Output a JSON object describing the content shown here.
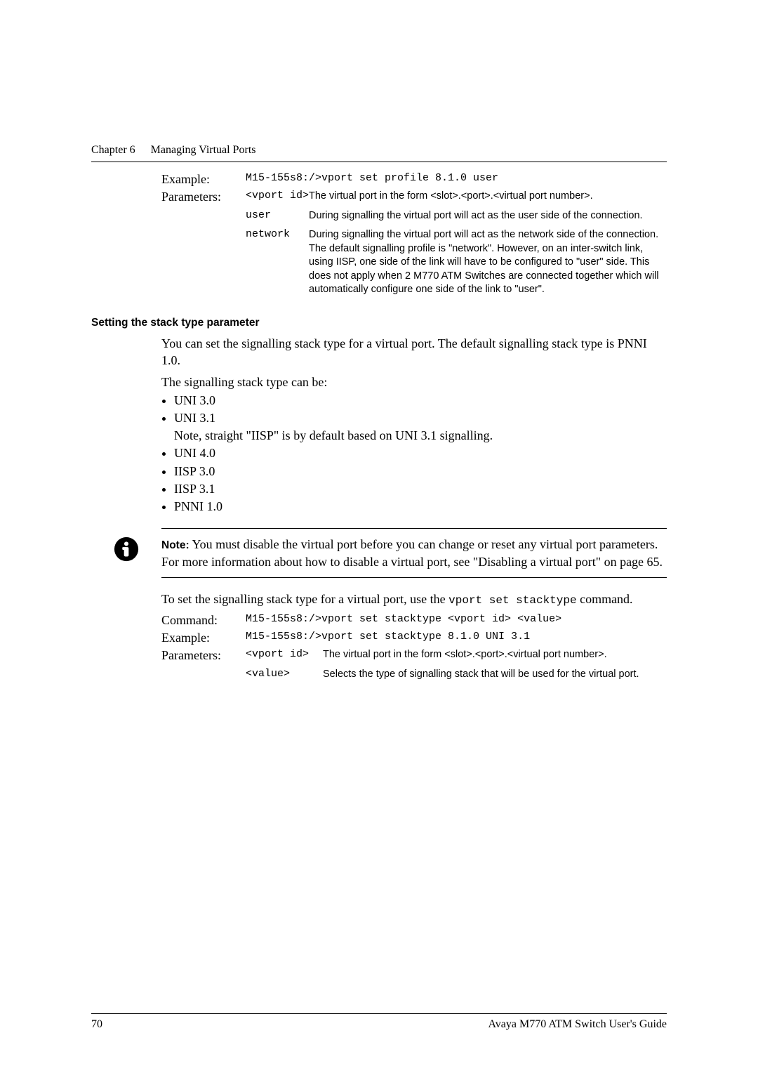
{
  "header": {
    "chapter_label": "Chapter 6",
    "chapter_title": "Managing Virtual Ports"
  },
  "block1": {
    "example_label": "Example:",
    "example_value": "M15-155s8:/>vport set profile 8.1.0 user",
    "parameters_label": "Parameters:",
    "params": [
      {
        "name": "<vport id>",
        "desc": "The virtual port in the form <slot>.<port>.<virtual port number>."
      },
      {
        "name": "user",
        "desc": "During signalling the virtual port will act as the user side of the connection."
      },
      {
        "name": "network",
        "desc": "During signalling the virtual port will act as the network side of the connection. The default signalling profile is \"network\". However, on an inter-switch link, using IISP, one side of the link will have to be configured to \"user\" side. This does not apply when 2 M770 ATM Switches are connected together which will automatically configure one side of the link to \"user\"."
      }
    ]
  },
  "section2": {
    "heading": "Setting the stack type parameter",
    "para1": "You can set the signalling stack type for a virtual port. The default signalling stack type is PNNI 1.0.",
    "para2": "The signalling stack type can be:",
    "list": {
      "i1": "UNI 3.0",
      "i2": "UNI 3.1",
      "i2_sub": "Note, straight \"IISP\" is by default based on UNI 3.1 signalling.",
      "i3": "UNI 4.0",
      "i4": "IISP 3.0",
      "i5": "IISP 3.1",
      "i6": "PNNI 1.0"
    }
  },
  "note": {
    "label": "Note:",
    "text": "  You must disable the virtual port before you can change or reset any virtual port parameters. For more information about how to disable a virtual port, see \"Disabling a virtual port\" on page 65."
  },
  "block2": {
    "intro_pre": "To set the signalling stack type for a virtual port, use the ",
    "intro_code": "vport set stacktype",
    "intro_post": " command.",
    "command_label": "Command:",
    "command_value": "M15-155s8:/>vport set stacktype <vport id> <value>",
    "example_label": "Example:",
    "example_value": "M15-155s8:/>vport set stacktype 8.1.0 UNI 3.1",
    "parameters_label": "Parameters:",
    "params": [
      {
        "name": "<vport id>",
        "desc": "The virtual port in the form <slot>.<port>.<virtual port number>."
      },
      {
        "name": "<value>",
        "desc": "Selects the type of signalling stack that will be used for the virtual port."
      }
    ]
  },
  "footer": {
    "page": "70",
    "title": "Avaya M770 ATM Switch User's Guide"
  }
}
